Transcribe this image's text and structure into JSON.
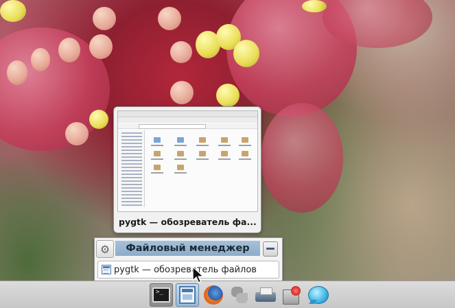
{
  "preview": {
    "window_title": "pygtk — обозреватель фа..."
  },
  "group_popup": {
    "header": "Файловый менеджер",
    "items": [
      {
        "label": "pygtk — обозреватель файлов",
        "icon": "file-manager-icon"
      }
    ],
    "settings_icon": "gear-icon",
    "minimize_icon": "minimize-icon"
  },
  "panel": {
    "launchers": [
      {
        "name": "terminal",
        "icon": "terminal-icon"
      },
      {
        "name": "file-manager",
        "icon": "file-manager-icon",
        "active": true
      },
      {
        "name": "firefox",
        "icon": "firefox-icon"
      },
      {
        "name": "python",
        "icon": "python-icon"
      },
      {
        "name": "printer",
        "icon": "printer-icon"
      },
      {
        "name": "software-manager",
        "icon": "software-manager-icon"
      },
      {
        "name": "chat",
        "icon": "chat-icon"
      }
    ],
    "terminal_glyph": ">_"
  },
  "colors": {
    "group_header_bg": "#9bb7d2",
    "minimize_bar": "#3b5d86",
    "panel_bg": "#d2d2d2"
  }
}
